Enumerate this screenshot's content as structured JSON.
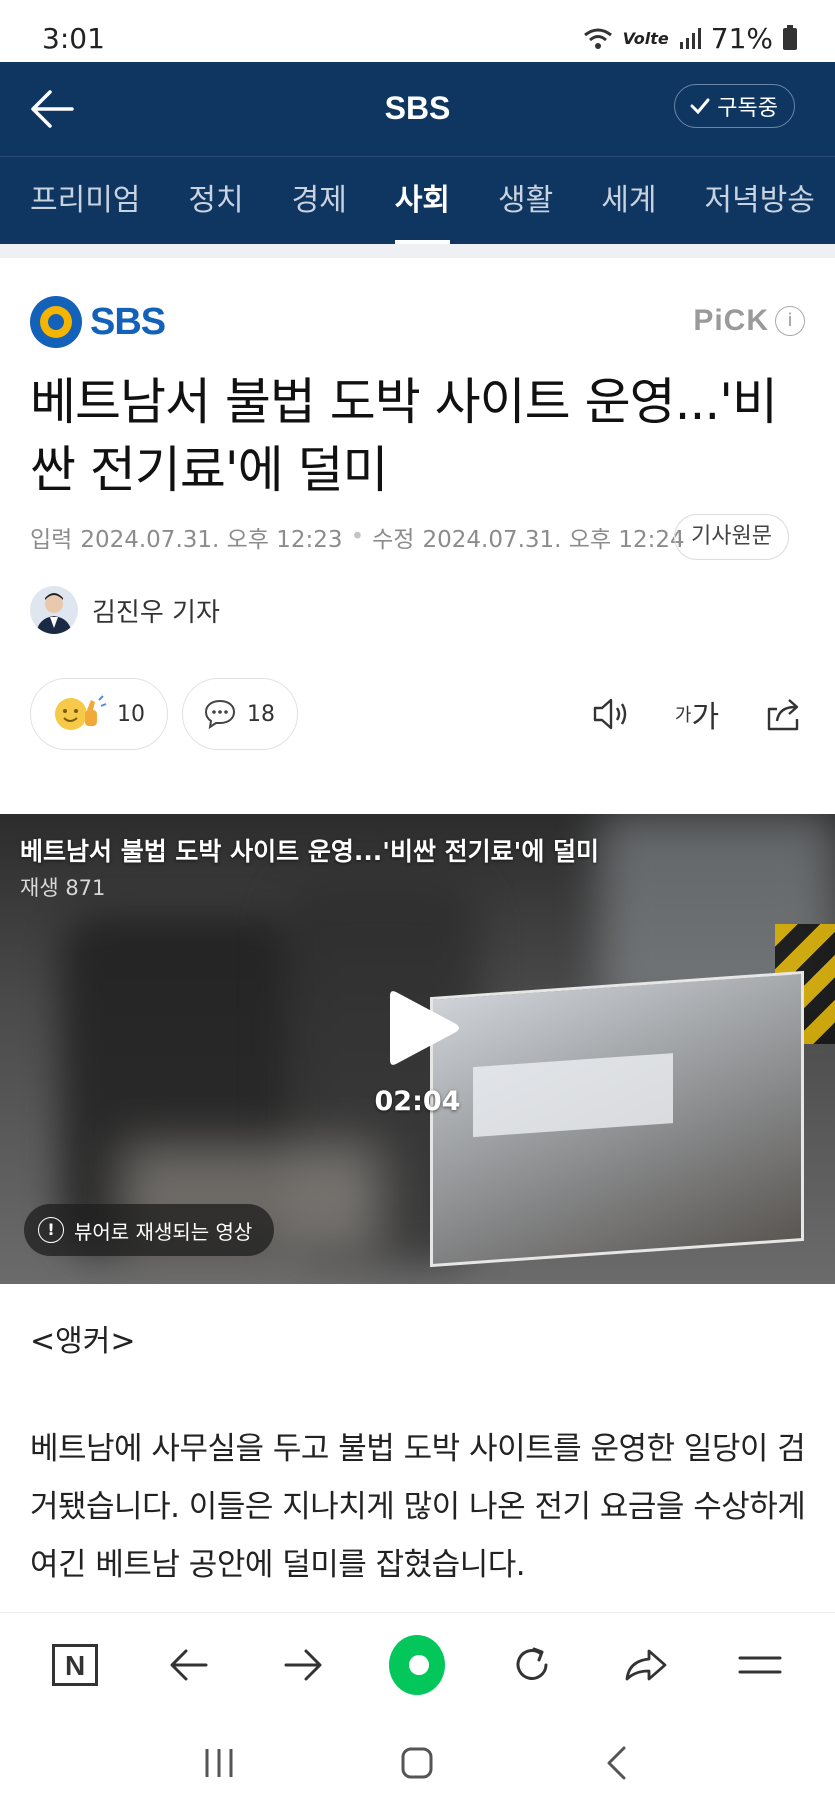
{
  "status_bar": {
    "time": "3:01",
    "network": "Volte",
    "battery": "71%"
  },
  "header": {
    "title": "SBS",
    "subscribe_label": "구독중"
  },
  "tabs": [
    {
      "label": "프리미엄",
      "active": false
    },
    {
      "label": "정치",
      "active": false
    },
    {
      "label": "경제",
      "active": false
    },
    {
      "label": "사회",
      "active": true
    },
    {
      "label": "생활",
      "active": false
    },
    {
      "label": "세계",
      "active": false
    },
    {
      "label": "저녁방송",
      "active": false
    }
  ],
  "article": {
    "press": "SBS",
    "pick_label": "PiCK",
    "info_glyph": "i",
    "headline": "베트남서 불법 도박 사이트 운영...'비싼 전기료'에 덜미",
    "input_label": "입력",
    "input_time": "2024.07.31. 오후 12:23",
    "modified_label": "수정",
    "modified_time": "2024.07.31. 오후 12:24",
    "original_button": "기사원문",
    "reporter": "김진우 기자",
    "reaction_count": "10",
    "comment_count": "18",
    "font_small": "가",
    "font_large": "가"
  },
  "video": {
    "title": "베트남서 불법 도박 사이트 운영...'비싼 전기료'에 덜미",
    "views": "재생 871",
    "duration": "02:04",
    "viewer_notice": "뷰어로 재생되는 영상"
  },
  "body": {
    "anchor": "<앵커>",
    "paragraph": "베트남에 사무실을 두고 불법 도박 사이트를 운영한 일당이 검거됐습니다. 이들은 지나치게 많이 나온 전기 요금을 수상하게 여긴 베트남 공안에 덜미를 잡혔습니다."
  },
  "toolbar": {
    "home_glyph": "N"
  },
  "colors": {
    "header_bg": "#0f3561",
    "naver_green": "#03c75a",
    "sbs_blue": "#1361b8",
    "sbs_yellow": "#f4b400"
  }
}
